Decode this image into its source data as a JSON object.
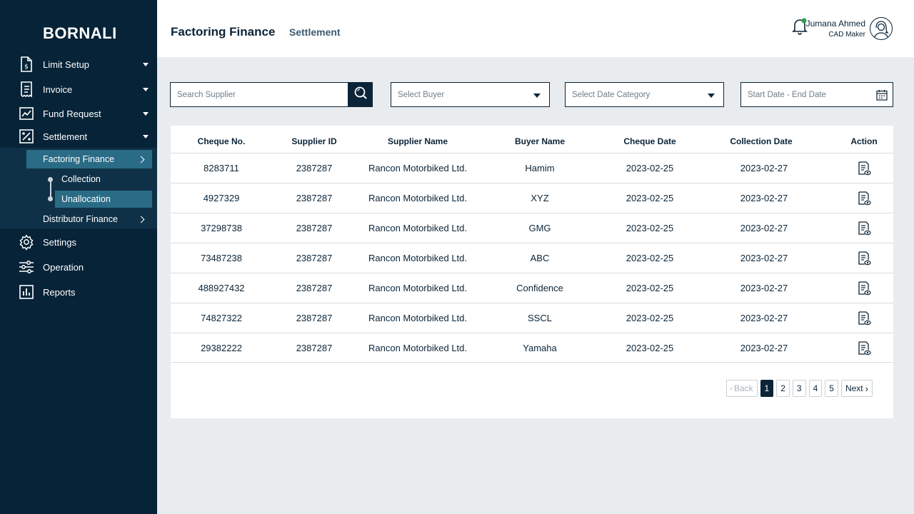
{
  "brand": "BORNALI",
  "sidebar": {
    "items": [
      {
        "label": "Limit Setup",
        "icon": "document-dollar-icon"
      },
      {
        "label": "Invoice",
        "icon": "receipt-icon"
      },
      {
        "label": "Fund Request",
        "icon": "chart-line-icon"
      },
      {
        "label": "Settlement",
        "icon": "percent-icon"
      },
      {
        "label": "Settings",
        "icon": "gear-icon"
      },
      {
        "label": "Operation",
        "icon": "sliders-icon"
      },
      {
        "label": "Reports",
        "icon": "bar-chart-icon"
      }
    ],
    "settlement_sub": {
      "factoring": "Factoring Finance",
      "collection": "Collection",
      "unallocation": "Unallocation",
      "distributor": "Distributor Finance"
    }
  },
  "header": {
    "title": "Factoring Finance",
    "subtitle": "Settlement",
    "user_name": "Jumana Ahmed",
    "user_role": "CAD Maker"
  },
  "filters": {
    "search_placeholder": "Search Supplier",
    "buyer_placeholder": "Select Buyer",
    "date_category_placeholder": "Select Date Category",
    "date_range_placeholder": "Start Date - End Date"
  },
  "table": {
    "headers": [
      "Cheque No.",
      "Supplier ID",
      "Supplier Name",
      "Buyer Name",
      "Cheque Date",
      "Collection Date",
      "Action"
    ],
    "rows": [
      [
        "8283711",
        "2387287",
        "Rancon Motorbiked Ltd.",
        "Hamim",
        "2023-02-25",
        "2023-02-27"
      ],
      [
        "4927329",
        "2387287",
        "Rancon Motorbiked Ltd.",
        "XYZ",
        "2023-02-25",
        "2023-02-27"
      ],
      [
        "37298738",
        "2387287",
        "Rancon Motorbiked Ltd.",
        "GMG",
        "2023-02-25",
        "2023-02-27"
      ],
      [
        "73487238",
        "2387287",
        "Rancon Motorbiked Ltd.",
        "ABC",
        "2023-02-25",
        "2023-02-27"
      ],
      [
        "488927432",
        "2387287",
        "Rancon Motorbiked Ltd.",
        "Confidence",
        "2023-02-25",
        "2023-02-27"
      ],
      [
        "74827322",
        "2387287",
        "Rancon Motorbiked Ltd.",
        "SSCL",
        "2023-02-25",
        "2023-02-27"
      ],
      [
        "29382222",
        "2387287",
        "Rancon Motorbiked Ltd.",
        "Yamaha",
        "2023-02-25",
        "2023-02-27"
      ]
    ]
  },
  "pagination": {
    "back": "Back",
    "next": "Next",
    "pages": [
      "1",
      "2",
      "3",
      "4",
      "5"
    ],
    "current": "1"
  },
  "colors": {
    "sidebar_bg": "#072338",
    "accent": "#2a6b86",
    "notification_dot": "#2e9e4f"
  }
}
